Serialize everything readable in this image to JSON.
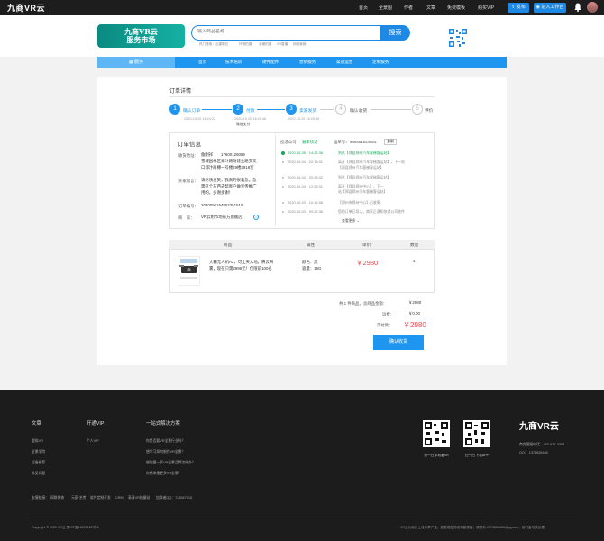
{
  "topbar": {
    "logo": "九商VR云",
    "nav": [
      "首页",
      "全景图",
      "作者",
      "文章",
      "免费模板",
      "购买VIP"
    ],
    "publish": "发布",
    "workspace": "进入工作台"
  },
  "header": {
    "brand_line1": "九商VR云",
    "brand_line2": "服务市场",
    "search_placeholder": "输入商品名称",
    "search_button": "搜索",
    "hot_tags": [
      "热门搜索：云建职位",
      "环物拍摄",
      "全景拍摄",
      "VR直播",
      "网络营销"
    ]
  },
  "nav": {
    "all": "服务",
    "items": [
      "首页",
      "技术培训",
      "硬件配件",
      "营销服务",
      "渠道运营",
      "定制服务"
    ]
  },
  "page_title": "订单详情",
  "steps": [
    {
      "num": "1",
      "label": "确认订单",
      "date": "2020-10-20 16:24:22",
      "sub": ""
    },
    {
      "num": "2",
      "label": "付款",
      "date": "2020-10-20 16:25:46",
      "sub": "微信支付"
    },
    {
      "num": "3",
      "label": "卖家发货",
      "date": "2020-10-20 16:25:46",
      "sub": ""
    },
    {
      "num": "4",
      "label": "确认收货",
      "date": "",
      "sub": ""
    },
    {
      "num": "5",
      "label": "评价",
      "date": "",
      "sub": ""
    }
  ],
  "order_info": {
    "title": "订单信息",
    "address_label": "收货地址：",
    "address_name": "詹刚祥",
    "address_phone": "17600126089",
    "address_lines": [
      "雪城园林区郑汴路与建业路交叉",
      "口郑汴商樽一号楼29楼2918室"
    ],
    "message_label": "买家留言：",
    "message_lines": [
      "请尽快发货，我真的很着急。急",
      "需这个东西去帮客户做宣传推广",
      "用的。多谢多谢！"
    ],
    "order_no_label": "订单编号：",
    "order_no": "2020092154852351515",
    "seller_label": "商　家：",
    "seller": "VR云厨市场省方旗舰店"
  },
  "logistics": {
    "company_label": "投递公司：",
    "company": "顺丰快递",
    "waybill_label": "运单号：",
    "waybill": "985561564521",
    "copy": "复制",
    "more": "查看更多",
    "entries": [
      {
        "time": "2020-10-05　14:22:36",
        "text": "到达【郑县郑州汽车客梯客运站】"
      },
      {
        "time": "2020-10-04　22:18:31",
        "text": "离开【郑县郑州汽车客梯客运站】，下一站"
      },
      {
        "time": "",
        "text": "【郑县郑州汽车客梯客运站】"
      },
      {
        "time": "2020-10-04　20:26:42",
        "text": "到达【郑县郑州汽车客梯客运站】"
      },
      {
        "time": "2020-10-04　12:29:31",
        "text": "离开【郑县郑州中心】，下一"
      },
      {
        "time": "",
        "text": "站【郑县郑州汽车客梯客运站】"
      },
      {
        "time": "2020-10-03　10:12:58",
        "text": "【郑州市郑州中心】已收寄"
      },
      {
        "time": "2020-10-03　09:22:36",
        "text": "您的订单已导入，商家正通知快递公司收件"
      }
    ]
  },
  "table": {
    "headers": [
      "商品",
      "属性",
      "单价",
      "数量"
    ],
    "product_name_lines": [
      "大疆无人机A2，可上天入地。腾云驾",
      "雾，现在只需2999元！仅限前100名"
    ],
    "attr_lines": [
      "颜色：黑",
      "容量：16G"
    ],
    "price": "￥2980",
    "qty": "1"
  },
  "summary": {
    "total_label": "共 1 件商品，总商品金额：",
    "total": "￥2980",
    "freight_label": "运费：",
    "freight": "￥0.00",
    "paid_label": "实付款：",
    "paid": "￥2980",
    "confirm": "确认收货"
  },
  "footer": {
    "cols": [
      {
        "title": "文章",
        "links": [
          "虚拟VR",
          "全景学院",
          "设备推荐",
          "常见问题"
        ]
      },
      {
        "title": "开通VIP",
        "links": [
          "个人VIP"
        ]
      },
      {
        "title": "一站式解决方案",
        "links": [
          "你是否要VR全景行业吗？",
          "想学习如何制作VR全景？",
          "想加盟一家VR全景品牌怎样办？",
          "你想承接更多VR全景？"
        ]
      }
    ],
    "friend_links": [
      "友情链接：",
      "网联装修",
      "元豪·艺考",
      "软件定制开发",
      "CRM",
      "高清VR拍摄站",
      "加群者QQ：733347315"
    ],
    "qr1": "扫一扫 手机看VR",
    "qr2": "扫一扫 下载APP",
    "logo": "九商VR云",
    "contact1": "商务客服电话：400-677-3398",
    "contact2": "QQ：   1373826480",
    "copyright": "Copyright © 2020 VR云 豫ICP备18027122号-3",
    "right_text": "VR云为用户上传分享产生，如发现您的权利被侵害，请联系 1373826480@qq.com，我们会尽快处理"
  },
  "colors": {
    "accent": "#1e96f0",
    "price": "#f5424e",
    "brand": "#0e9387",
    "footer": "#1c1c1c"
  }
}
